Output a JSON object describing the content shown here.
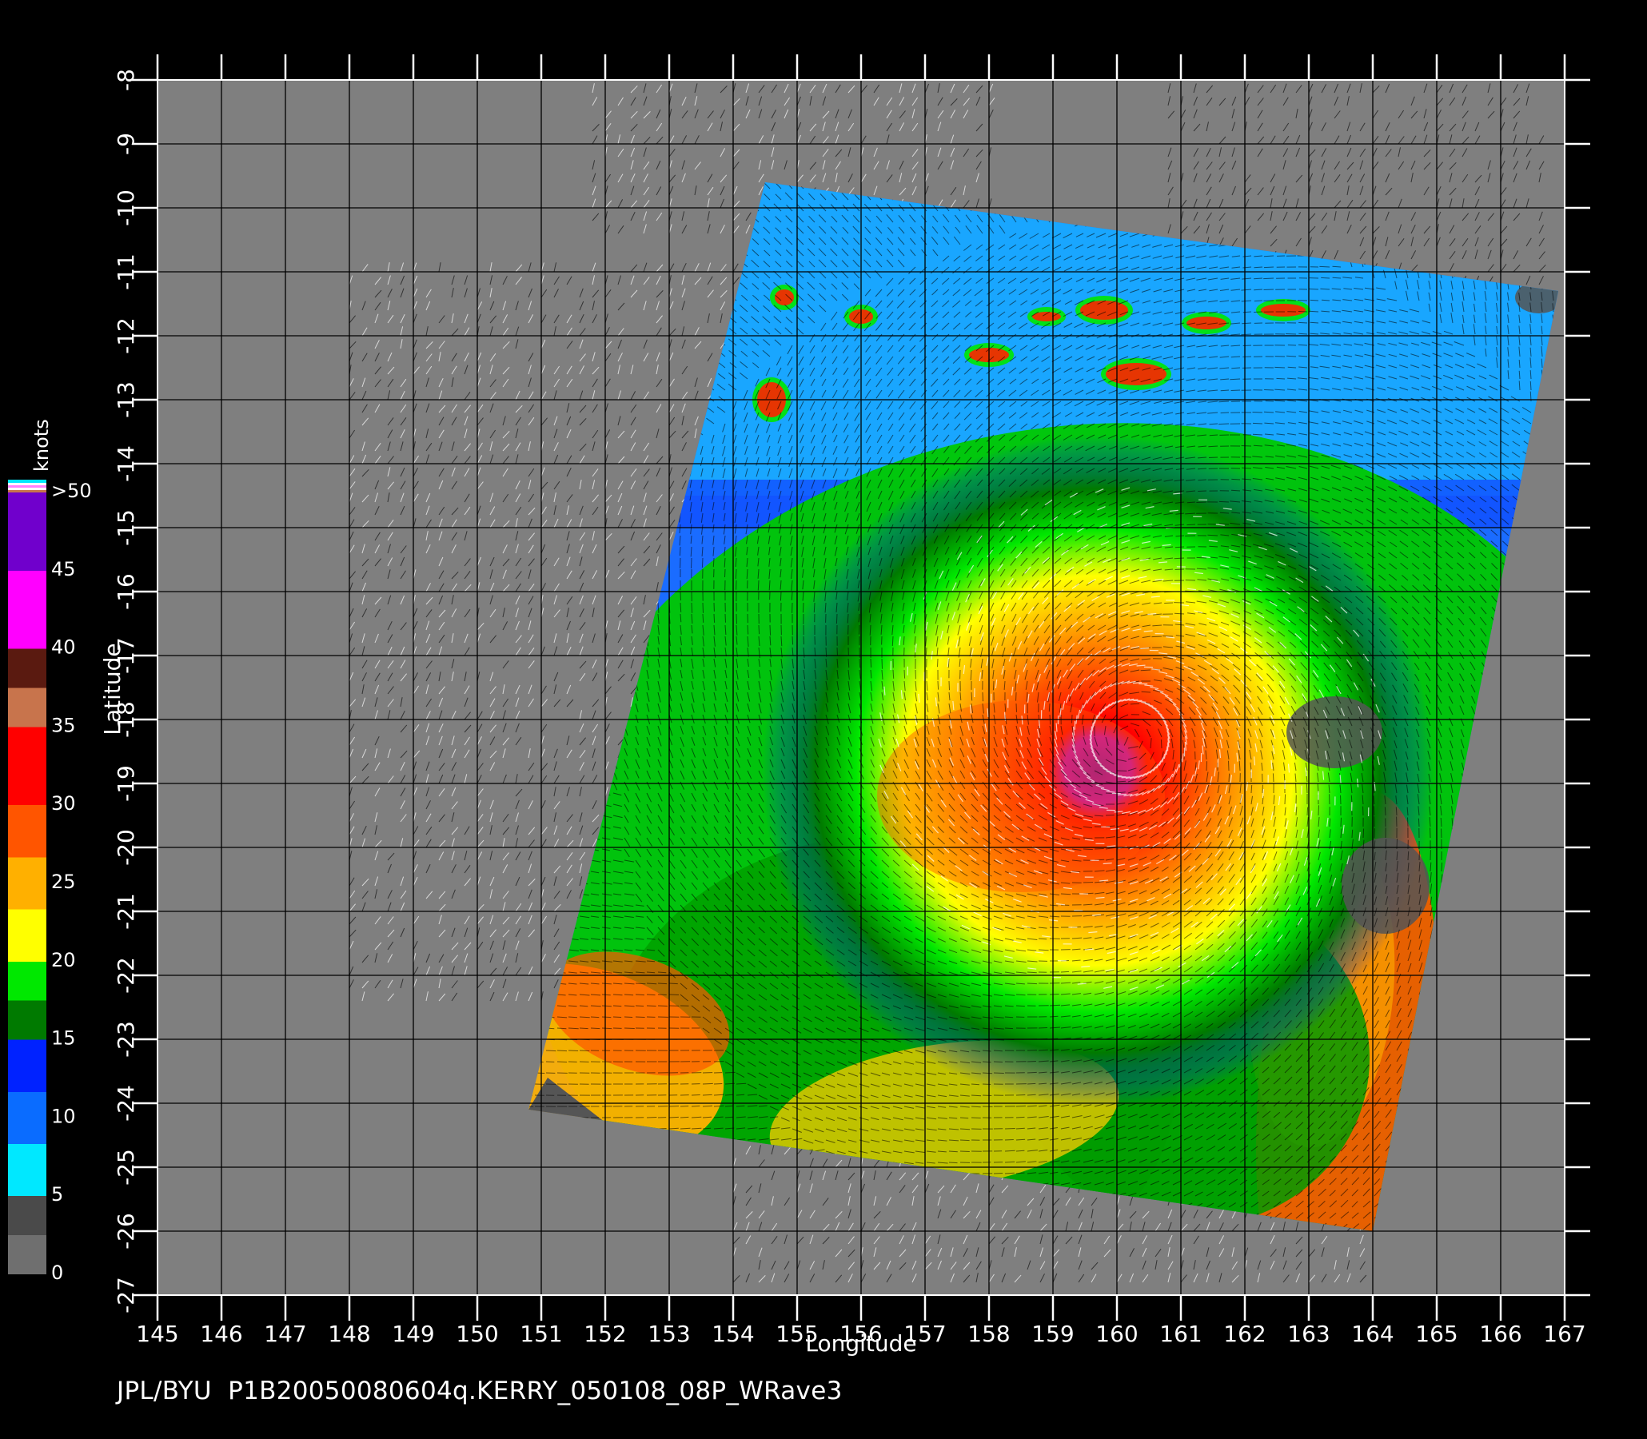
{
  "map": {
    "x_axis_label": "Longitude",
    "y_axis_label": "Latitude",
    "lon_ticks": [
      "145",
      "146",
      "147",
      "148",
      "149",
      "150",
      "151",
      "152",
      "153",
      "154",
      "155",
      "156",
      "157",
      "158",
      "159",
      "160",
      "161",
      "162",
      "163",
      "164",
      "165",
      "166",
      "167"
    ],
    "lat_ticks": [
      "-8",
      "-9",
      "-10",
      "-11",
      "-12",
      "-13",
      "-14",
      "-15",
      "-16",
      "-17",
      "-18",
      "-19",
      "-20",
      "-21",
      "-22",
      "-23",
      "-24",
      "-25",
      "-26",
      "-27"
    ],
    "lon_range": [
      145,
      167
    ],
    "lat_range": [
      -27,
      -8
    ],
    "grid": true,
    "background_color": "#7f7f7f",
    "swath_corners_lonlat": [
      [
        154.5,
        -9.6
      ],
      [
        166.9,
        -11.3
      ],
      [
        164.0,
        -26.0
      ],
      [
        150.8,
        -24.1
      ]
    ],
    "storm_center_lonlat": [
      160.2,
      -18.3
    ],
    "footer_text": "JPL/BYU  P1B20050080604q.KERRY_050108_08P_WRave3"
  },
  "colorbar": {
    "unit_label": "knots",
    "tick_labels": [
      ">50",
      "45",
      "40",
      "35",
      "30",
      "25",
      "20",
      "15",
      "10",
      "5",
      "0"
    ],
    "bands": [
      {
        "from": 0,
        "to": 5,
        "colors": [
          "#6f6f6f",
          "#4a4a4a"
        ]
      },
      {
        "from": 5,
        "to": 15,
        "colors": [
          "#00e8ff",
          "#0a6cff",
          "#0022ff"
        ]
      },
      {
        "from": 15,
        "to": 20,
        "colors": [
          "#007a00",
          "#00e800"
        ]
      },
      {
        "from": 20,
        "to": 30,
        "colors": [
          "#ffff00",
          "#ffb000",
          "#ff5500"
        ]
      },
      {
        "from": 30,
        "to": 35,
        "colors": [
          "#ff0000"
        ]
      },
      {
        "from": 35,
        "to": 40,
        "colors": [
          "#c8744c",
          "#5a1a10"
        ]
      },
      {
        "from": 40,
        "to": 50,
        "colors": [
          "#ff00ff",
          "#7000cc"
        ]
      }
    ]
  }
}
